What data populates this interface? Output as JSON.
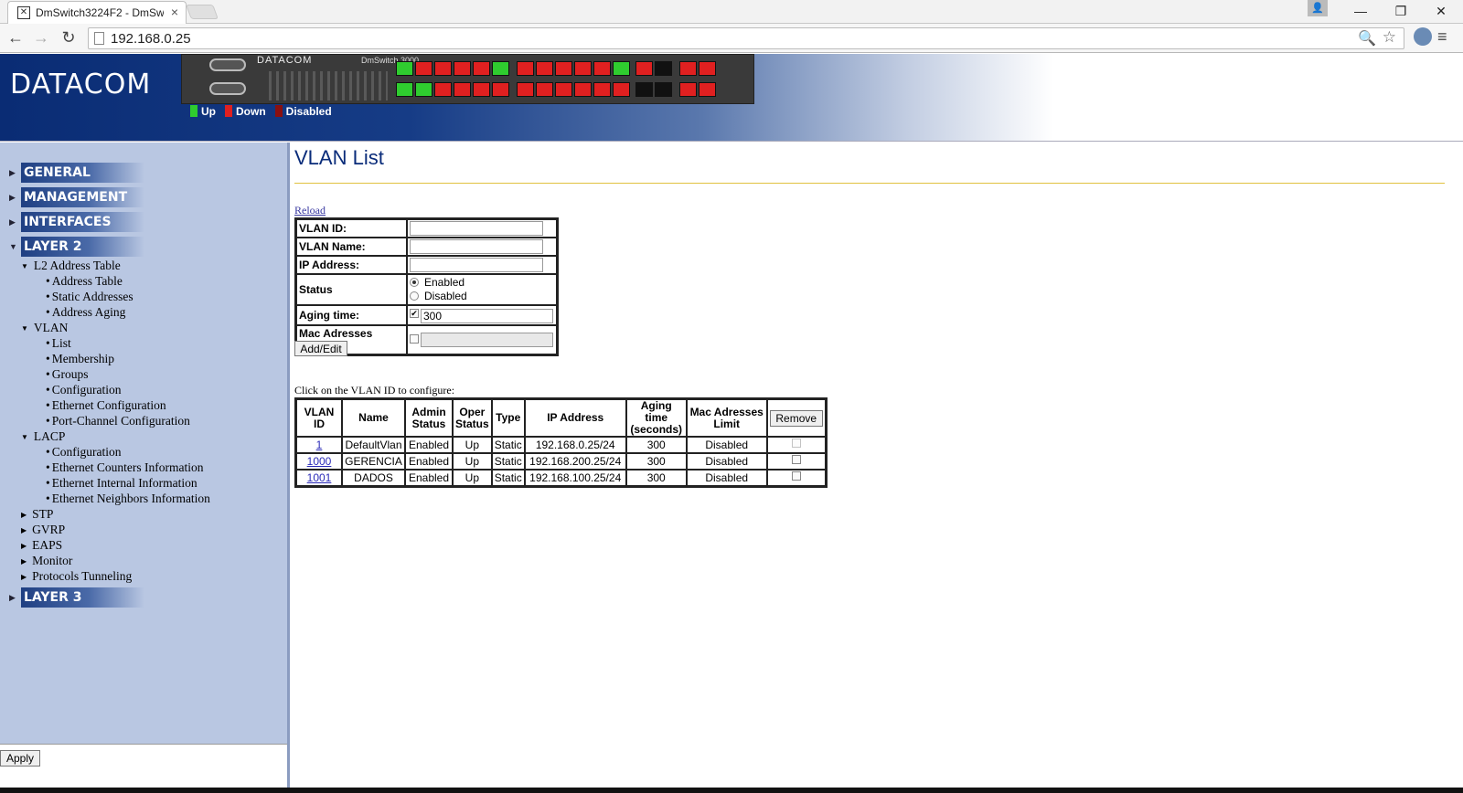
{
  "browser": {
    "tab_title": "DmSwitch3224F2 - DmSw",
    "url": "192.168.0.25"
  },
  "header": {
    "logo": "DATACOM",
    "switch_brand": "DATACOM",
    "switch_model": "DmSwitch 3000",
    "legend": {
      "up": "Up",
      "down": "Down",
      "disabled": "Disabled"
    },
    "colors": {
      "up": "#2fcc2f",
      "down": "#e02020",
      "disabled": "#8a1010"
    }
  },
  "sidebar": {
    "sections": {
      "general": "GENERAL",
      "management": "MANAGEMENT",
      "interfaces": "INTERFACES",
      "layer2": "LAYER 2",
      "layer3": "LAYER 3"
    },
    "l2_address_table": "L2 Address Table",
    "address_table": "Address Table",
    "static_addresses": "Static Addresses",
    "address_aging": "Address Aging",
    "vlan": "VLAN",
    "vlan_list": "List",
    "vlan_membership": "Membership",
    "vlan_groups": "Groups",
    "vlan_configuration": "Configuration",
    "vlan_eth_config": "Ethernet Configuration",
    "vlan_pc_config": "Port-Channel Configuration",
    "lacp": "LACP",
    "lacp_configuration": "Configuration",
    "lacp_counters": "Ethernet Counters Information",
    "lacp_internal": "Ethernet Internal Information",
    "lacp_neighbors": "Ethernet Neighbors Information",
    "stp": "STP",
    "gvrp": "GVRP",
    "eaps": "EAPS",
    "monitor": "Monitor",
    "protocols_tunneling": "Protocols Tunneling",
    "apply": "Apply"
  },
  "main": {
    "title": "VLAN List",
    "reload": "Reload",
    "form": {
      "vlan_id_label": "VLAN ID:",
      "vlan_name_label": "VLAN Name:",
      "ip_address_label": "IP Address:",
      "status_label": "Status",
      "status_enabled": "Enabled",
      "status_disabled": "Disabled",
      "status_selected": "Enabled",
      "aging_label": "Aging time:",
      "aging_value": "300",
      "mac_limit_label": "Mac Adresses Limit:",
      "vlan_id_value": "",
      "vlan_name_value": "",
      "ip_address_value": ""
    },
    "add_edit": "Add/Edit",
    "hint": "Click on the VLAN ID to configure:",
    "table": {
      "headers": {
        "vlan_id": "VLAN ID",
        "name": "Name",
        "admin1": "Admin",
        "admin2": "Status",
        "oper1": "Oper",
        "oper2": "Status",
        "type": "Type",
        "ip": "IP Address",
        "aging1": "Aging time",
        "aging2": "(seconds)",
        "mac1": "Mac Adresses",
        "mac2": "Limit",
        "remove": "Remove"
      },
      "rows": [
        {
          "id": "1",
          "name": "DefaultVlan",
          "admin": "Enabled",
          "oper": "Up",
          "type": "Static",
          "ip": "192.168.0.25/24",
          "aging": "300",
          "limit": "Disabled"
        },
        {
          "id": "1000",
          "name": "GERENCIA",
          "admin": "Enabled",
          "oper": "Up",
          "type": "Static",
          "ip": "192.168.200.25/24",
          "aging": "300",
          "limit": "Disabled"
        },
        {
          "id": "1001",
          "name": "DADOS",
          "admin": "Enabled",
          "oper": "Up",
          "type": "Static",
          "ip": "192.168.100.25/24",
          "aging": "300",
          "limit": "Disabled"
        }
      ]
    }
  }
}
